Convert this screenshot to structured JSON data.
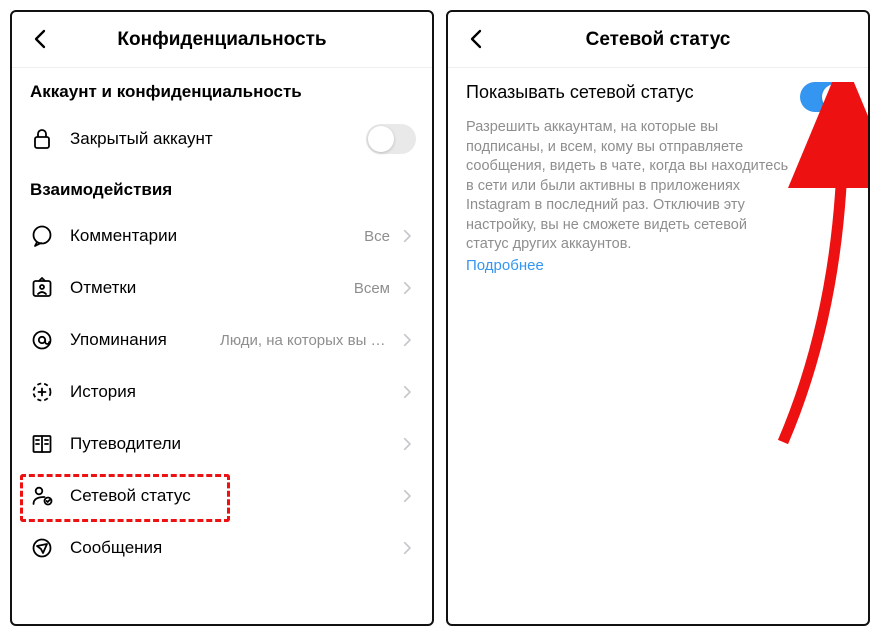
{
  "left": {
    "title": "Конфиденциальность",
    "section_account": "Аккаунт и конфиденциальность",
    "private_label": "Закрытый аккаунт",
    "private_on": false,
    "section_interact": "Взаимодействия",
    "rows": [
      {
        "key": "comments",
        "label": "Комментарии",
        "value": "Все"
      },
      {
        "key": "tags",
        "label": "Отметки",
        "value": "Всем"
      },
      {
        "key": "mentions",
        "label": "Упоминания",
        "value": "Люди, на которых вы п…"
      },
      {
        "key": "story",
        "label": "История",
        "value": ""
      },
      {
        "key": "guides",
        "label": "Путеводители",
        "value": ""
      },
      {
        "key": "activity",
        "label": "Сетевой статус",
        "value": ""
      },
      {
        "key": "messages",
        "label": "Сообщения",
        "value": ""
      }
    ],
    "highlight_index": 5
  },
  "right": {
    "title": "Сетевой статус",
    "setting_label": "Показывать сетевой статус",
    "setting_on": true,
    "description": "Разрешить аккаунтам, на которые вы подписаны, и всем, кому вы отправляете сообщения, видеть в чате, когда вы находитесь в сети или были активны в приложениях Instagram в последний раз. Отключив эту настройку, вы не сможете видеть сетевой статус других аккаунтов.",
    "link": "Подробнее"
  },
  "colors": {
    "accent": "#3496f0",
    "annotation_red": "#e11"
  }
}
